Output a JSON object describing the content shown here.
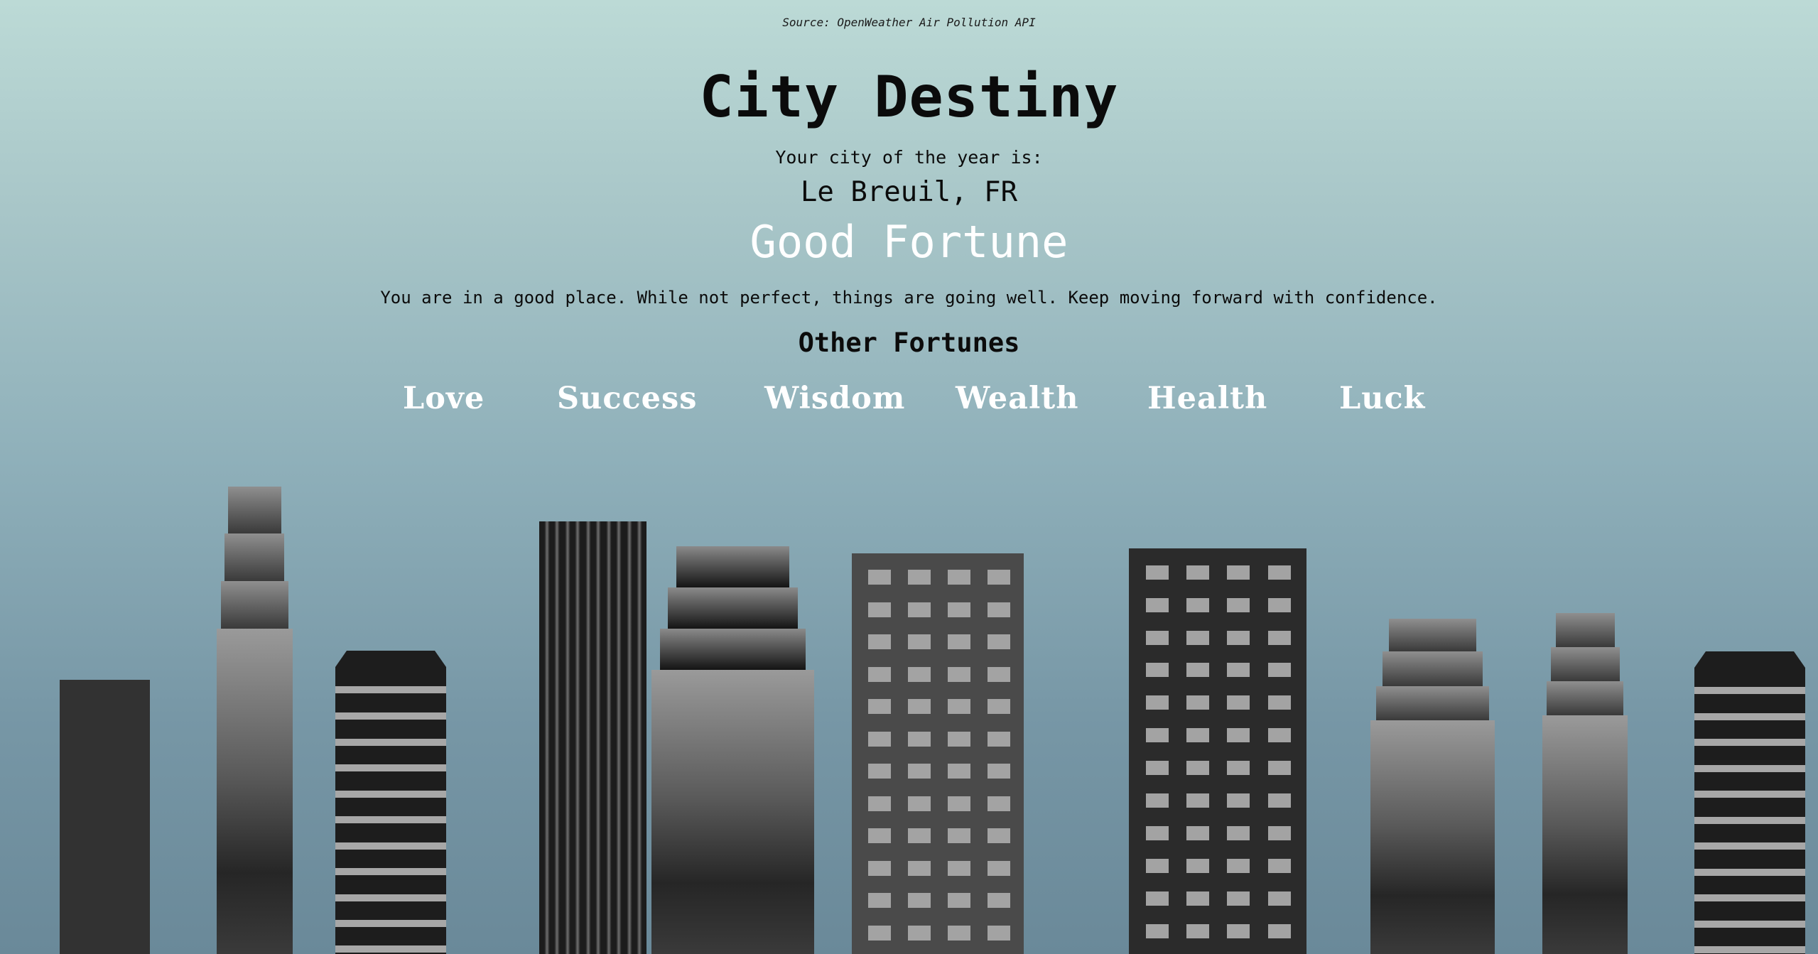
{
  "source": "Source: OpenWeather Air Pollution API",
  "title": "City Destiny",
  "subtitle": "Your city of the year is:",
  "city": "Le Breuil, FR",
  "fortune": "Good Fortune",
  "description": "You are in a good place. While not perfect, things are going well. Keep moving forward with confidence.",
  "other_heading": "Other Fortunes",
  "other_fortunes": [
    "Love",
    "Success",
    "Wisdom",
    "Wealth",
    "Health",
    "Luck"
  ],
  "colors": {
    "sky_top": "#bcdad6",
    "sky_bottom": "#6a8999",
    "fortune_text": "#ffffff",
    "building_dark": "#2d2d2d",
    "window": "#a3a3a3"
  }
}
